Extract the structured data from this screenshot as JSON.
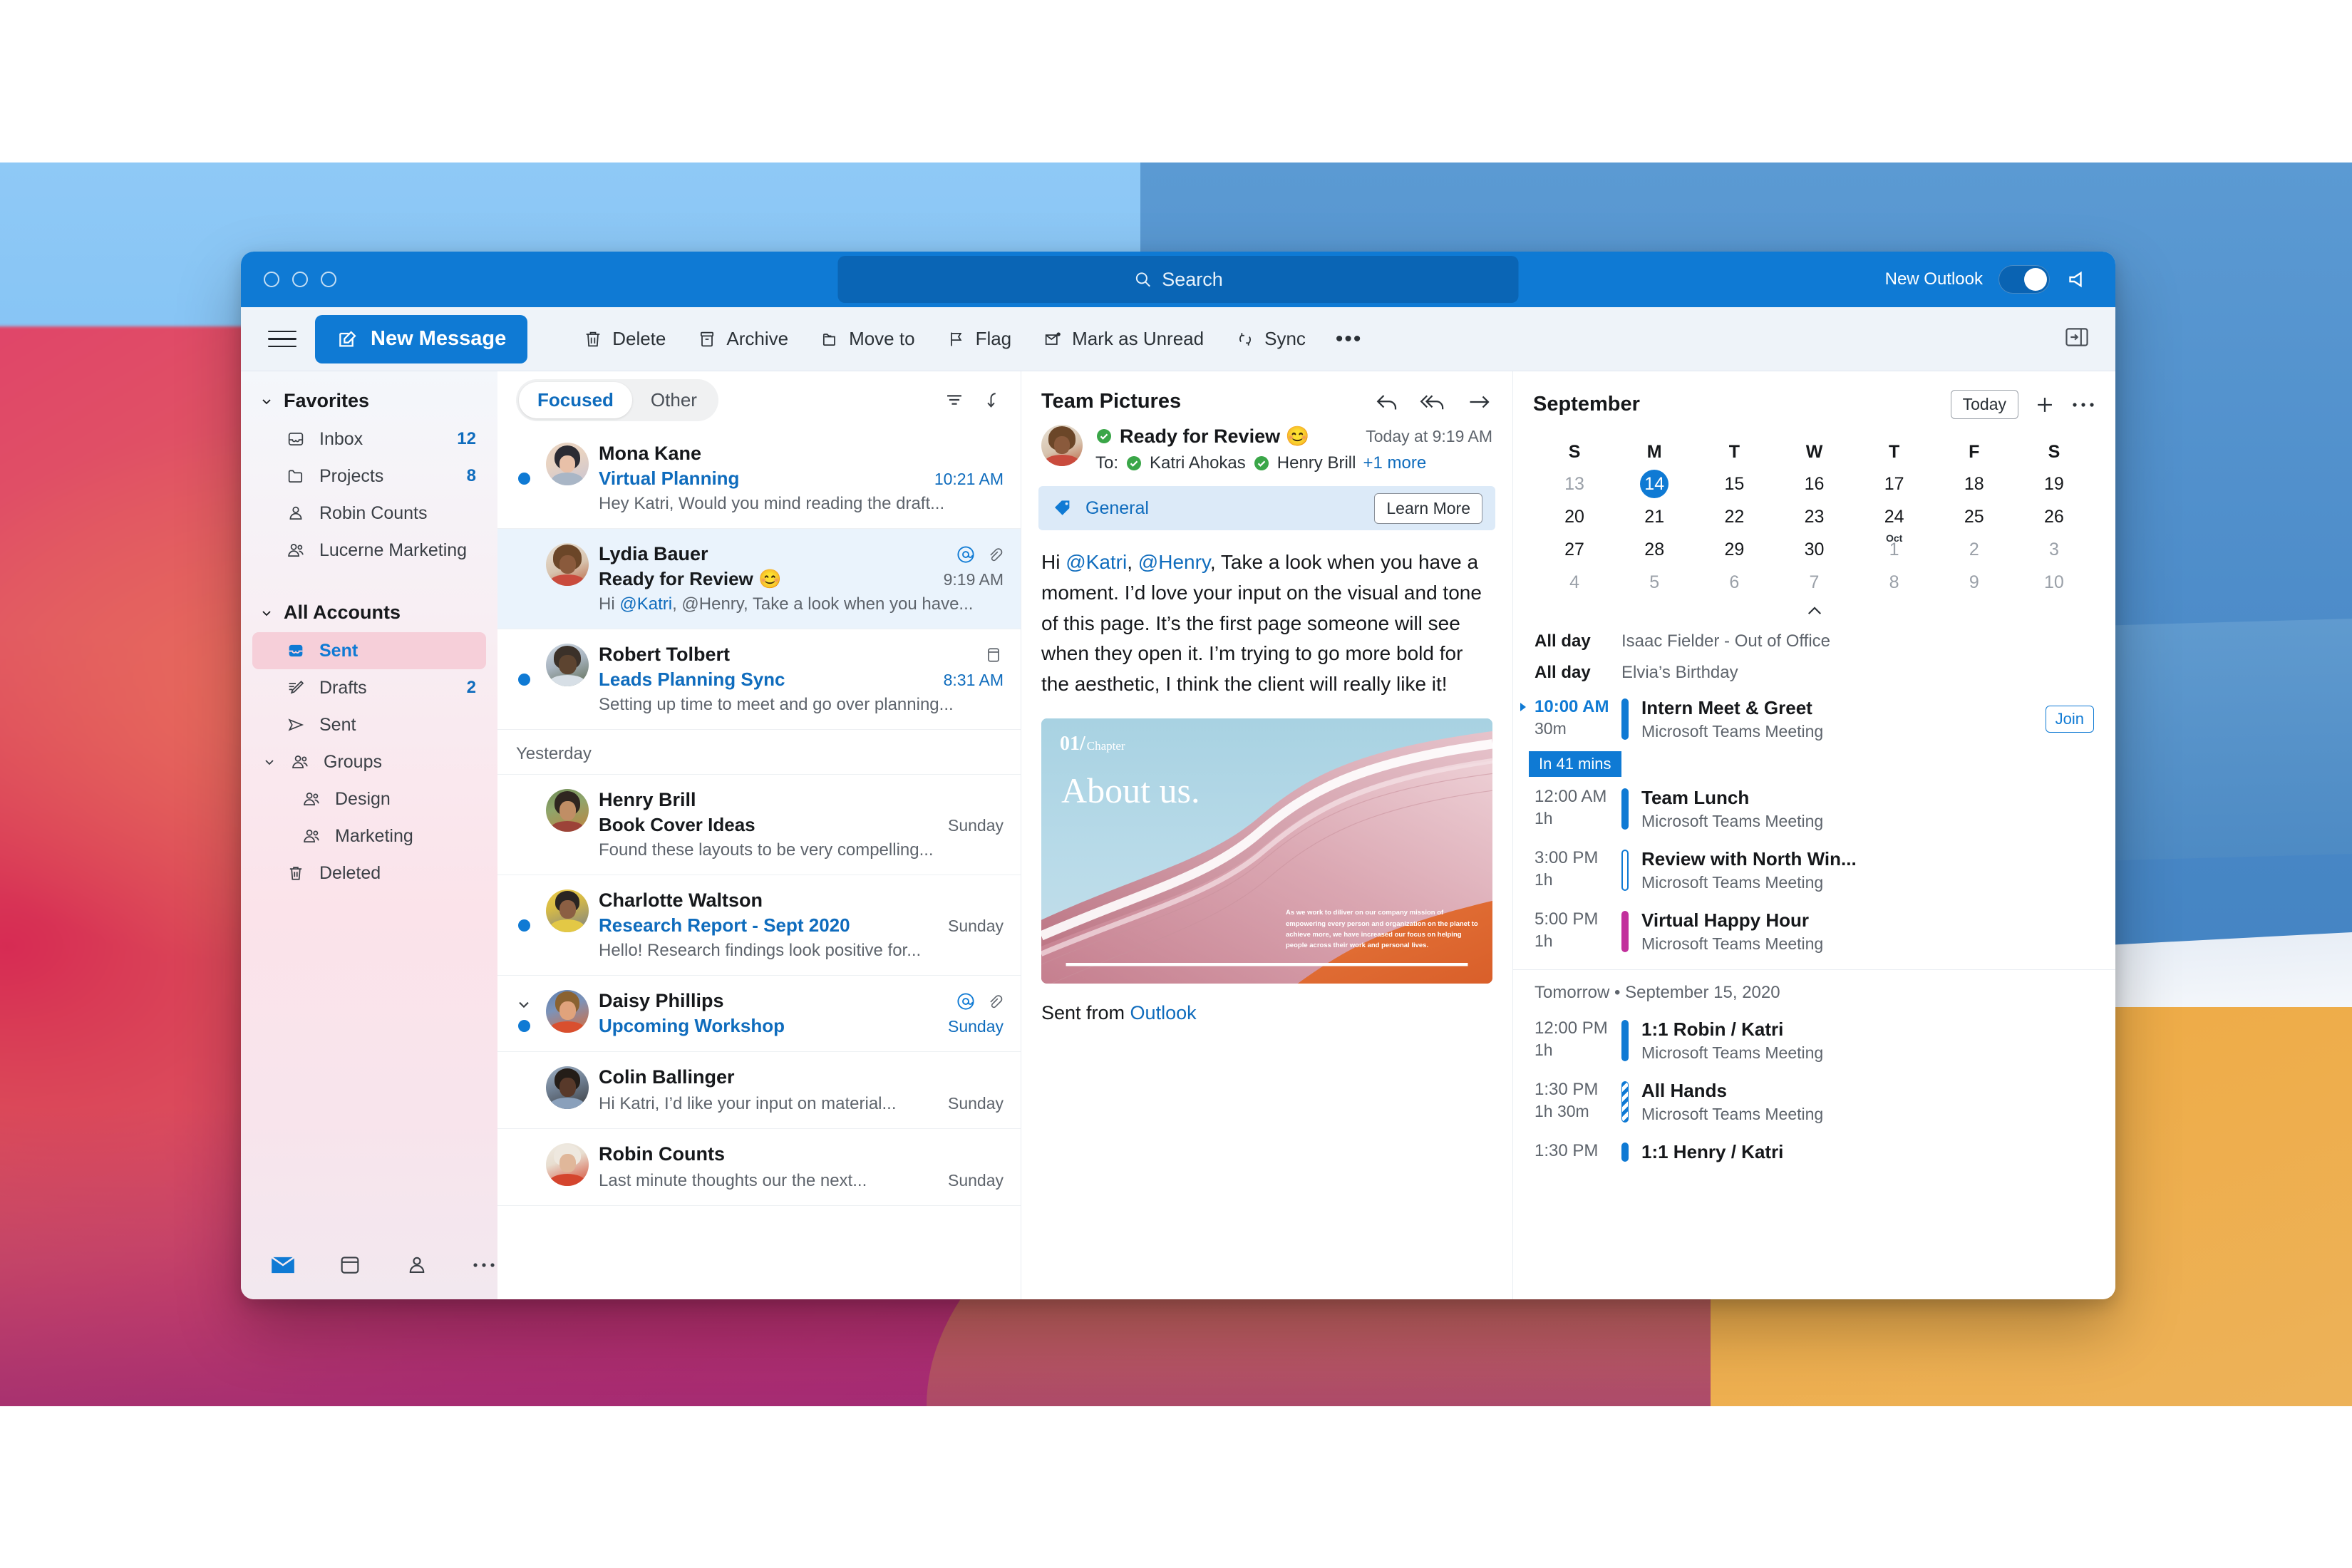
{
  "titlebar": {
    "search_placeholder": "Search",
    "new_outlook_label": "New Outlook",
    "toggle_state": "on",
    "feedback_icon": "megaphone-icon"
  },
  "commandbar": {
    "new_message_label": "New Message",
    "items": [
      {
        "label": "Delete",
        "icon": "trash-icon"
      },
      {
        "label": "Archive",
        "icon": "archive-icon"
      },
      {
        "label": "Move to",
        "icon": "folder-arrow-icon"
      },
      {
        "label": "Flag",
        "icon": "flag-icon"
      },
      {
        "label": "Mark as Unread",
        "icon": "envelope-dot-icon"
      },
      {
        "label": "Sync",
        "icon": "sync-icon"
      }
    ],
    "overflow_label": "•••",
    "panel_toggle_icon": "open-pane-icon"
  },
  "sidebar": {
    "groups": [
      {
        "label": "Favorites",
        "items": [
          {
            "label": "Inbox",
            "count": "12",
            "icon": "inbox-icon",
            "level": 1,
            "selected": false
          },
          {
            "label": "Projects",
            "count": "8",
            "icon": "folder-icon",
            "level": 1,
            "selected": false
          },
          {
            "label": "Robin Counts",
            "count": "",
            "icon": "person-icon",
            "level": 1,
            "selected": false
          },
          {
            "label": "Lucerne Marketing",
            "count": "",
            "icon": "people-icon",
            "level": 1,
            "selected": false
          }
        ]
      },
      {
        "label": "All Accounts",
        "items": [
          {
            "label": "Sent",
            "count": "",
            "icon": "inbox-filled-icon",
            "level": 1,
            "selected": true
          },
          {
            "label": "Drafts",
            "count": "2",
            "icon": "draft-pencil-icon",
            "level": 1,
            "selected": false
          },
          {
            "label": "Sent",
            "count": "",
            "icon": "send-icon",
            "level": 1,
            "selected": false
          },
          {
            "label": "Groups",
            "count": "",
            "icon": "people-icon",
            "level": 1,
            "selected": false,
            "expandable": true
          },
          {
            "label": "Design",
            "count": "",
            "icon": "people-icon",
            "level": 2,
            "selected": false
          },
          {
            "label": "Marketing",
            "count": "",
            "icon": "people-icon",
            "level": 2,
            "selected": false
          },
          {
            "label": "Deleted",
            "count": "",
            "icon": "trash-icon",
            "level": 1,
            "selected": false
          }
        ]
      }
    ],
    "bottom_nav": [
      "mail-icon",
      "calendar-icon",
      "people-icon",
      "more-dots-icon"
    ]
  },
  "messagelist": {
    "pivots": [
      {
        "label": "Focused",
        "active": true
      },
      {
        "label": "Other",
        "active": false
      }
    ],
    "filter_icon": "filter-icon",
    "sort_icon": "sort-down-icon",
    "sections": [
      {
        "header": "",
        "messages": [
          {
            "from": "Mona Kane",
            "subject": "Virtual Planning",
            "preview": "Hey Katri, Would you mind reading the draft...",
            "time": "10:21 AM",
            "unread": true,
            "selected": false,
            "avatar_colors": [
              "#2b2b33",
              "#e8c0a8"
            ],
            "icons": []
          },
          {
            "from": "Lydia Bauer",
            "subject": "Ready for Review 😊",
            "preview_prefix": "Hi ",
            "preview_mention": "@Katri",
            "preview_rest": ", @Henry, Take a look when you have...",
            "time": "9:19 AM",
            "unread": false,
            "selected": true,
            "avatar_colors": [
              "#d8b39a",
              "#8a5a3c"
            ],
            "icons": [
              "mention-icon",
              "attachment-icon"
            ]
          },
          {
            "from": "Robert Tolbert",
            "subject": "Leads Planning Sync",
            "preview": "Setting up time to meet and go over planning...",
            "time": "8:31 AM",
            "unread": true,
            "selected": false,
            "avatar_colors": [
              "#4a4038",
              "#c9d6e2"
            ],
            "icons": [
              "calendar-icon"
            ]
          }
        ]
      },
      {
        "header": "Yesterday",
        "messages": [
          {
            "from": "Henry Brill",
            "subject": "Book Cover Ideas",
            "preview": "Found these layouts to be very compelling...",
            "time": "Sunday",
            "unread": false,
            "selected": false,
            "avatar_colors": [
              "#3c4a34",
              "#b98a62"
            ],
            "icons": []
          },
          {
            "from": "Charlotte Waltson",
            "subject": "Research Report - Sept 2020",
            "preview": "Hello! Research findings look positive for...",
            "time": "Sunday",
            "unread": true,
            "selected": false,
            "avatar_colors": [
              "#e8c84a",
              "#3a3330"
            ],
            "icons": []
          },
          {
            "from": "Daisy Phillips",
            "subject": "Upcoming Workshop",
            "preview": "",
            "time": "Sunday",
            "unread": true,
            "selected": false,
            "collapsed_thread": true,
            "avatar_colors": [
              "#5f7fae",
              "#e2a37c"
            ],
            "icons": [
              "mention-icon",
              "attachment-icon"
            ]
          },
          {
            "from": "Colin Ballinger",
            "subject": "",
            "preview": "Hi Katri, I’d like your input on material...",
            "time": "Sunday",
            "unread": false,
            "selected": false,
            "avatar_colors": [
              "#4a3f38",
              "#8e9bb0"
            ],
            "icons": []
          },
          {
            "from": "Robin Counts",
            "subject": "",
            "preview": "Last minute thoughts our the next...",
            "time": "Sunday",
            "unread": false,
            "selected": false,
            "avatar_colors": [
              "#e8e4de",
              "#d4452e"
            ],
            "icons": []
          }
        ]
      }
    ]
  },
  "reading": {
    "title": "Team Pictures",
    "actions": [
      "reply-icon",
      "reply-all-icon",
      "forward-icon"
    ],
    "subject": "Ready for Review 😊",
    "date": "Today at 9:19 AM",
    "to_label": "To:",
    "recipients": [
      "Katri Ahokas",
      "Henry Brill"
    ],
    "more_recipients": "+1 more",
    "sensitivity_label": "General",
    "sensitivity_icon": "tag-icon",
    "learn_more_label": "Learn More",
    "body": {
      "prefix": "Hi ",
      "mention1": "@Katri",
      "middle": ", ",
      "mention2": "@Henry",
      "rest": ", Take a look when you have a moment. I’d love your input on the visual and tone of this page. It’s the first page someone will see when they open it. I’m trying to go more bold for the aesthetic, I think the client will really like it!"
    },
    "attachment_card": {
      "chapter_number": "01/",
      "chapter_word": "Chapter",
      "headline": "About us.",
      "caption": "As we work to diliver on our company mission of empowering every person and organization on the planet to achieve more, we have increased our focus on helping people across their work and personal lives."
    },
    "signature_prefix": "Sent from ",
    "signature_link": "Outlook"
  },
  "calendar": {
    "month": "September",
    "today_label": "Today",
    "add_icon": "plus-icon",
    "more_icon": "more-dots-icon",
    "collapse_icon": "chevron-up-icon",
    "dow": [
      "S",
      "M",
      "T",
      "W",
      "T",
      "F",
      "S"
    ],
    "weeks": [
      [
        {
          "d": "13",
          "dim": true
        },
        {
          "d": "14",
          "today": true
        },
        {
          "d": "15"
        },
        {
          "d": "16"
        },
        {
          "d": "17"
        },
        {
          "d": "18"
        },
        {
          "d": "19"
        }
      ],
      [
        {
          "d": "20"
        },
        {
          "d": "21"
        },
        {
          "d": "22"
        },
        {
          "d": "23"
        },
        {
          "d": "24"
        },
        {
          "d": "25"
        },
        {
          "d": "26"
        }
      ],
      [
        {
          "d": "27"
        },
        {
          "d": "28"
        },
        {
          "d": "29"
        },
        {
          "d": "30"
        },
        {
          "d": "1",
          "dim": true,
          "monthlabel": "Oct"
        },
        {
          "d": "2",
          "dim": true
        },
        {
          "d": "3",
          "dim": true
        }
      ],
      [
        {
          "d": "4",
          "dim": true
        },
        {
          "d": "5",
          "dim": true
        },
        {
          "d": "6",
          "dim": true
        },
        {
          "d": "7",
          "dim": true
        },
        {
          "d": "8",
          "dim": true
        },
        {
          "d": "9",
          "dim": true
        },
        {
          "d": "10",
          "dim": true
        }
      ]
    ],
    "allday_events": [
      {
        "label": "All day",
        "title": "Isaac Fielder - Out of Office"
      },
      {
        "label": "All day",
        "title": "Elvia’s Birthday"
      }
    ],
    "today_events": [
      {
        "time": "10:00 AM",
        "duration": "30m",
        "title": "Intern Meet & Greet",
        "subtitle": "Microsoft Teams Meeting",
        "bar_color": "#0f7ad4",
        "bar_style": "solid",
        "join_label": "Join",
        "is_next": true
      },
      {
        "time": "12:00 AM",
        "duration": "1h",
        "title": "Team Lunch",
        "subtitle": "Microsoft Teams Meeting",
        "bar_color": "#0f7ad4",
        "bar_style": "solid"
      },
      {
        "time": "3:00 PM",
        "duration": "1h",
        "title": "Review with North Win...",
        "subtitle": "Microsoft Teams Meeting",
        "bar_color": "#0f7ad4",
        "bar_style": "outline"
      },
      {
        "time": "5:00 PM",
        "duration": "1h",
        "title": "Virtual Happy Hour",
        "subtitle": "Microsoft Teams Meeting",
        "bar_color": "#c2309c",
        "bar_style": "solid"
      }
    ],
    "now_pill": "In 41 mins",
    "tomorrow_header": "Tomorrow • September 15, 2020",
    "tomorrow_events": [
      {
        "time": "12:00 PM",
        "duration": "1h",
        "title": "1:1 Robin / Katri",
        "subtitle": "Microsoft Teams Meeting",
        "bar_color": "#0f7ad4",
        "bar_style": "solid"
      },
      {
        "time": "1:30 PM",
        "duration": "1h 30m",
        "title": "All Hands",
        "subtitle": "Microsoft Teams Meeting",
        "bar_color": "#0f7ad4",
        "bar_style": "striped"
      },
      {
        "time": "1:30 PM",
        "duration": "",
        "title": "1:1 Henry / Katri",
        "subtitle": "",
        "bar_color": "#0f7ad4",
        "bar_style": "solid"
      }
    ]
  },
  "colors": {
    "accent": "#0f7ad4",
    "link": "#0f6cbd",
    "titlebar": "#0f7ad4",
    "sidebar_selected": "#f6cfd9",
    "selected_row": "#eaf3fc",
    "purple_event": "#c2309c",
    "green_presence": "#3aa648"
  }
}
